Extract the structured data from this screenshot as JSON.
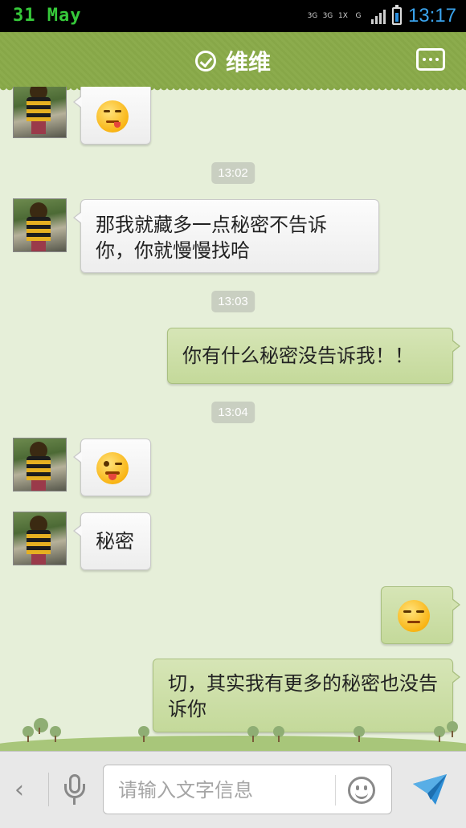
{
  "status_bar": {
    "date": "31 May",
    "network_top": [
      "3G",
      "3G",
      "1X",
      "G"
    ],
    "time": "13:17"
  },
  "header": {
    "title": "维维",
    "verified_icon": "check-circle-icon",
    "menu_icon": "more-options-icon"
  },
  "messages": [
    {
      "side": "left",
      "type": "emoji",
      "emoji": "tongue-out-face-emoji"
    },
    {
      "type": "time",
      "text": "13:02"
    },
    {
      "side": "left",
      "type": "text",
      "text": "那我就藏多一点秘密不告诉你，你就慢慢找哈"
    },
    {
      "type": "time",
      "text": "13:03"
    },
    {
      "side": "right",
      "type": "text",
      "text": "你有什么秘密没告诉我！！"
    },
    {
      "type": "time",
      "text": "13:04"
    },
    {
      "side": "left",
      "type": "emoji",
      "emoji": "wink-tongue-face-emoji"
    },
    {
      "side": "left",
      "type": "text",
      "text": "秘密"
    },
    {
      "side": "right",
      "type": "emoji",
      "emoji": "annoyed-face-emoji"
    },
    {
      "side": "right",
      "type": "text",
      "text": "切，其实我有更多的秘密也没告诉你"
    }
  ],
  "input_bar": {
    "back_icon": "chevron-left-icon",
    "voice_icon": "microphone-icon",
    "placeholder": "请输入文字信息",
    "value": "",
    "emoji_icon": "smiley-icon",
    "send_icon": "send-paper-plane-icon"
  },
  "colors": {
    "header_green": "#8cac4d",
    "chat_background": "#e6efd9",
    "outgoing_bubble": "#cfe1aa",
    "incoming_bubble": "#f5f5f5",
    "timestamp_bg": "#c9cfc1",
    "date_green": "#36c93a",
    "time_blue": "#3aa4ee"
  }
}
